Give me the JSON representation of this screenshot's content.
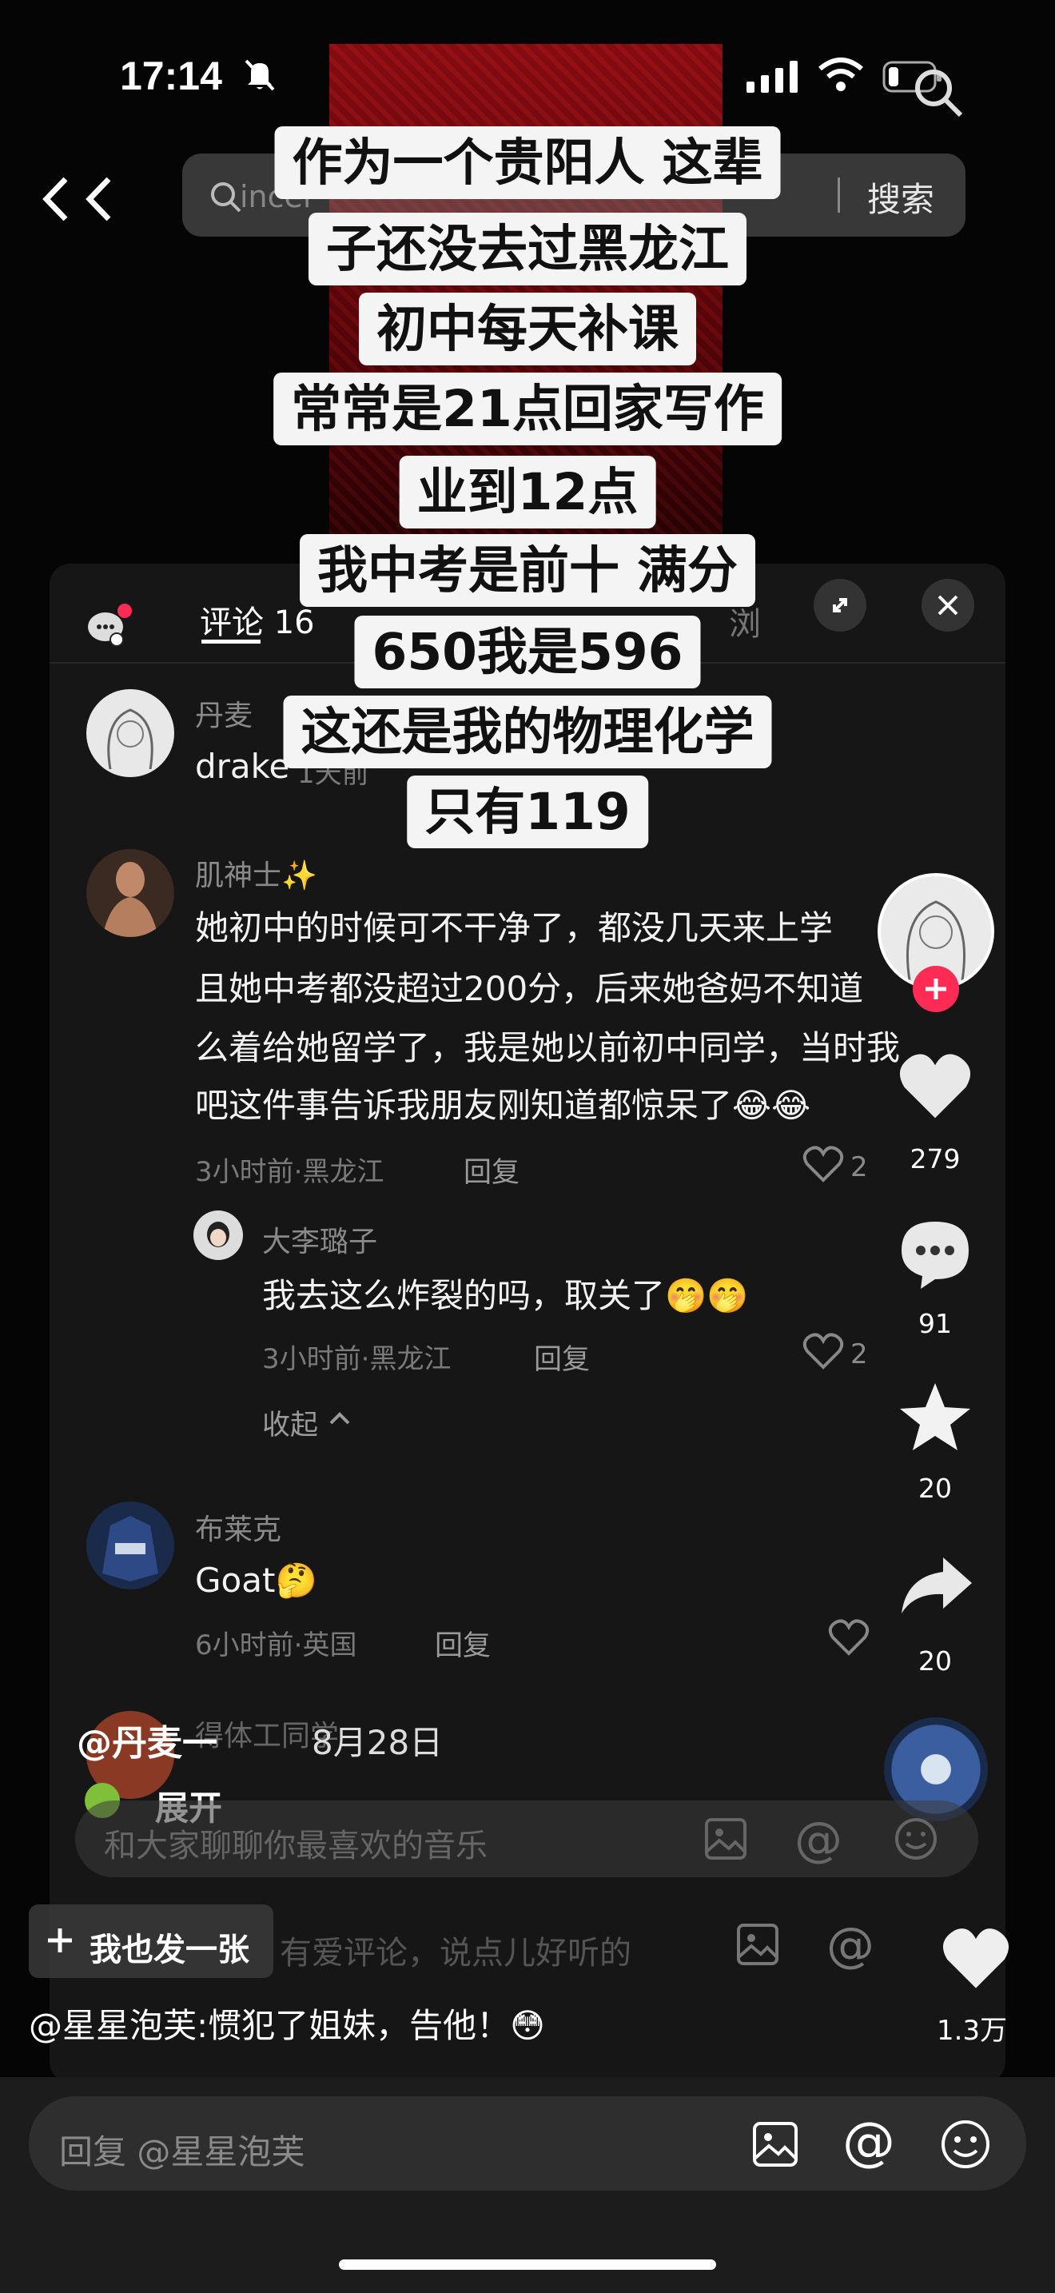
{
  "status_bar": {
    "time": "17:14"
  },
  "search": {
    "query": "incel",
    "button": "搜索"
  },
  "panel": {
    "tab_label": "评论 16",
    "tab_right": "浏"
  },
  "caption": {
    "lines": [
      "作为一个贵阳人 这辈",
      "子还没去过黑龙江",
      "初中每天补课",
      "常常是21点回家写作",
      "业到12点",
      "我中考是前十 满分",
      "650我是596",
      "这还是我的物理化学",
      "只有119"
    ]
  },
  "comments": [
    {
      "user": "丹麦",
      "text": "drake",
      "meta": "1天前"
    },
    {
      "user": "肌神士✨",
      "lines": [
        "她初中的时候可不干净了，都没几天来上学",
        "且她中考都没超过200分，后来她爸妈不知道",
        "么着给她留学了，我是她以前初中同学，当时我",
        "吧这件事告诉我朋友刚知道都惊呆了😂😂"
      ],
      "meta": "3小时前·黑龙江",
      "reply": "回复",
      "likes": "2"
    },
    {
      "user": "大李璐子",
      "text": "我去这么炸裂的吗，取关了🤭🤭",
      "meta": "3小时前·黑龙江",
      "reply": "回复",
      "likes": "2"
    },
    {
      "collapse": "收起"
    },
    {
      "user": "布莱克",
      "text": "Goat🤔",
      "meta": "6小时前·英国",
      "reply": "回复"
    },
    {
      "user": "得体工同学"
    }
  ],
  "right_rail": {
    "likes": "279",
    "comments": "91",
    "favorites": "20",
    "shares": "20",
    "main_likes": "1.3万"
  },
  "video_info": {
    "author": "@丹麦一",
    "date": "8月28日",
    "expand": "展开"
  },
  "music_input": {
    "placeholder": "和大家聊聊你最喜欢的音乐"
  },
  "share_button": "我也发一张",
  "comment_input_faded": "有爱评论，说点儿好听的",
  "top_comment": "@星星泡芙:惯犯了姐妹，告他！😳",
  "reply_input": {
    "placeholder": "回复 @星星泡芙"
  },
  "colors": {
    "like_badge": "#fe2c55",
    "panel": "#161616",
    "caption_bg": "#f4f4f4"
  }
}
